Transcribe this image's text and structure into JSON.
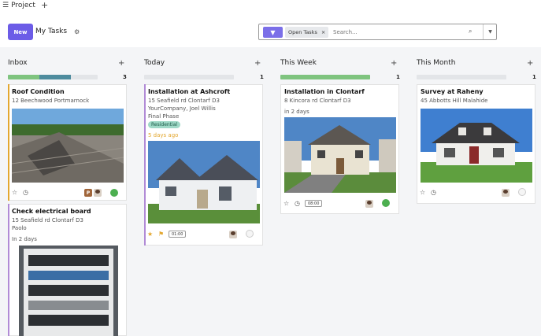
{
  "topbar": {
    "menu_label": "Project",
    "add_label": "+"
  },
  "control": {
    "new_label": "New",
    "breadcrumb": "My Tasks",
    "search": {
      "facet_label": "Open Tasks",
      "facet_remove": "×",
      "placeholder": "Search..."
    }
  },
  "columns": [
    {
      "title": "Inbox",
      "count": "1 3",
      "progress": [
        0.35,
        0.35,
        0.3
      ]
    },
    {
      "title": "Today",
      "count": "1",
      "progress": [
        0,
        0,
        1
      ]
    },
    {
      "title": "This Week",
      "count": "1",
      "progress": [
        0.9,
        0,
        0.1
      ]
    },
    {
      "title": "This Month",
      "count": "1",
      "progress": [
        0,
        0,
        1
      ]
    }
  ],
  "cards": {
    "roof": {
      "title": "Roof Condition",
      "address": "12 Beechwood Portmarnock",
      "avatar_letter": "P"
    },
    "electrical": {
      "title": "Check electrical board",
      "address": "15 Seafield rd Clontarf D3",
      "person": "Paolo",
      "due": "In 2 days"
    },
    "ashcroft": {
      "title": "Installation at Ashcroft",
      "address": "15 Seafield rd Clontarf D3",
      "company": "YourCompany, Joel Willis",
      "phase": "Final Phase",
      "tag": "Residential",
      "due": "5 days ago",
      "time": "01:00"
    },
    "clontarf": {
      "title": "Installation in Clontarf",
      "address": "8 Kincora rd Clontarf D3",
      "due": "in 2 days",
      "time": "08:00"
    },
    "raheny": {
      "title": "Survey at Raheny",
      "address": "45 Abbotts Hill Malahide"
    }
  },
  "colors": {
    "accent": "#6c5ce7",
    "green": "#4caf50",
    "teal": "#4e8c9e",
    "tag": "#9fd9c7",
    "warning": "#e3a72f"
  }
}
